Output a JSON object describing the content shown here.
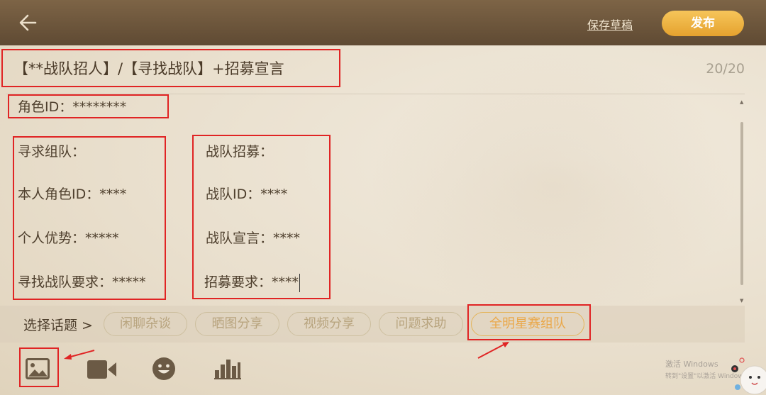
{
  "header": {
    "save_draft_label": "保存草稿",
    "publish_label": "发布"
  },
  "title": {
    "text": "【**战队招人】/【寻找战队】+招募宣言",
    "char_count": "20/20"
  },
  "body": {
    "role_id_line": "角色ID：********",
    "left_column": {
      "heading": "寻求组队：",
      "role_id": "本人角色ID：****",
      "advantage": "个人优势：*****",
      "requirement": "寻找战队要求：*****"
    },
    "right_column": {
      "heading": "战队招募：",
      "team_id": "战队ID：****",
      "declaration": "战队宣言：****",
      "requirement": "招募要求：****"
    }
  },
  "topics": {
    "label": "选择话题 >",
    "chips": [
      {
        "label": "闲聊杂谈",
        "active": false
      },
      {
        "label": "晒图分享",
        "active": false
      },
      {
        "label": "视频分享",
        "active": false
      },
      {
        "label": "问题求助",
        "active": false
      },
      {
        "label": "全明星赛组队",
        "active": true
      }
    ]
  },
  "toolbar": {
    "icons": [
      "image-icon",
      "video-icon",
      "emoji-icon",
      "chart-icon"
    ]
  },
  "watermark": {
    "line1": "激活 Windows",
    "line2": "转到\"设置\"以激活 Windows"
  },
  "colors": {
    "header": "#6f5740",
    "publish": "#efb443",
    "active_chip": "#eaa84a",
    "annotation": "#e02424"
  }
}
